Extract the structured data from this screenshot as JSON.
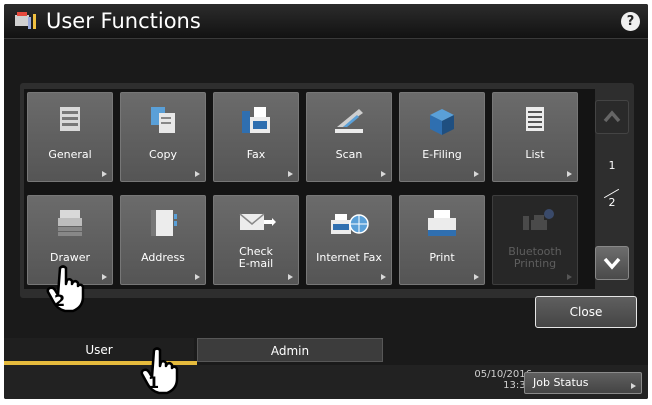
{
  "title": "User Functions",
  "help": {
    "label": "?"
  },
  "tiles": [
    {
      "label": "General",
      "icon": "printer-document-icon"
    },
    {
      "label": "Copy",
      "icon": "copy-documents-icon"
    },
    {
      "label": "Fax",
      "icon": "fax-machine-icon"
    },
    {
      "label": "Scan",
      "icon": "scanner-icon"
    },
    {
      "label": "E-Filing",
      "icon": "file-box-icon"
    },
    {
      "label": "List",
      "icon": "list-document-icon"
    },
    {
      "label": "Drawer",
      "icon": "drawer-printer-icon"
    },
    {
      "label": "Address",
      "icon": "address-book-icon"
    },
    {
      "label": "Check\nE-mail",
      "icon": "envelope-icon"
    },
    {
      "label": "Internet Fax",
      "icon": "internet-fax-icon"
    },
    {
      "label": "Print",
      "icon": "printer-icon"
    },
    {
      "label": "Bluetooth\nPrinting",
      "icon": "bluetooth-printer-icon",
      "disabled": true
    }
  ],
  "pagination": {
    "current": "1",
    "total": "2"
  },
  "close_label": "Close",
  "tabs": [
    {
      "label": "User"
    },
    {
      "label": "Admin"
    }
  ],
  "datetime": {
    "date": "05/10/2016",
    "time": "13:30"
  },
  "job_status_label": "Job Status",
  "callouts": [
    "2",
    "1"
  ],
  "colors": {
    "accent": "#e6bb3d",
    "tile": "#5f5f5f",
    "background": "#1a1a1a"
  }
}
